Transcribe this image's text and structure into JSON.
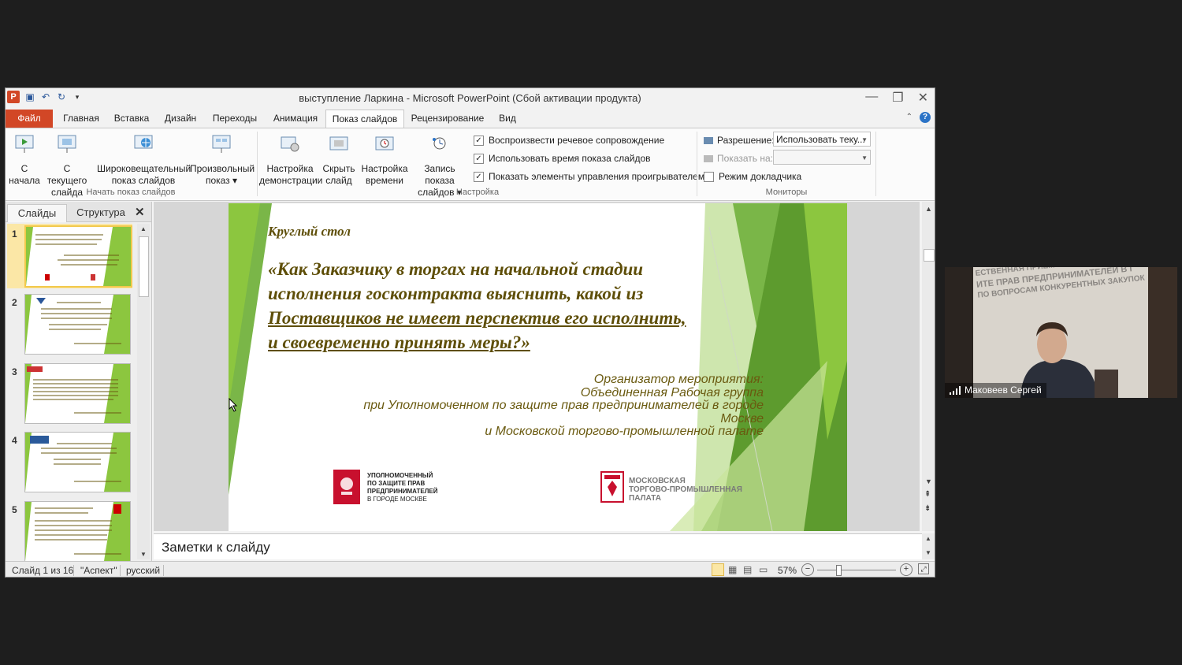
{
  "window": {
    "title": "выступление Ларкина  -  Microsoft PowerPoint (Сбой активации продукта)"
  },
  "tabs": [
    "Файл",
    "Главная",
    "Вставка",
    "Дизайн",
    "Переходы",
    "Анимация",
    "Показ слайдов",
    "Рецензирование",
    "Вид"
  ],
  "ribbon": {
    "start_group": "Начать показ слайдов",
    "setup_group": "Настройка",
    "monitors_group": "Мониторы",
    "btn_from_start": [
      "С",
      "начала"
    ],
    "btn_from_current": [
      "С текущего",
      "слайда"
    ],
    "btn_broadcast": [
      "Широковещательный",
      "показ слайдов"
    ],
    "btn_custom": [
      "Произвольный",
      "показ ▾"
    ],
    "btn_setup": [
      "Настройка",
      "демонстрации"
    ],
    "btn_hide": [
      "Скрыть",
      "слайд"
    ],
    "btn_timing": [
      "Настройка",
      "времени"
    ],
    "btn_record": [
      "Запись показа",
      "слайдов ▾"
    ],
    "chk_narration": "Воспроизвести речевое сопровождение",
    "chk_timings": "Использовать время показа слайдов",
    "chk_media": "Показать элементы управления проигрывателем",
    "resolution_label": "Разрешение:",
    "resolution_value": "Использовать теку...",
    "show_on_label": "Показать на:",
    "presenter_view": "Режим докладчика"
  },
  "panel": {
    "tab_slides": "Слайды",
    "tab_outline": "Структура",
    "close": "✕",
    "numbers": [
      "1",
      "2",
      "3",
      "4",
      "5"
    ]
  },
  "slide": {
    "heading": "Круглый стол",
    "title_lines": [
      "«Как Заказчику в торгах на начальной стадии",
      "исполнения госконтракта выяснить, какой из",
      "Поставщиков не имеет перспектив его исполнить,",
      "и своевременно принять меры?»"
    ],
    "org_lines": [
      "Организатор мероприятия:",
      "Объединенная Рабочая группа",
      "при Уполномоченном по защите прав предпринимателей в городе",
      "Москве",
      "и Московской торгово-промышленной палате"
    ],
    "logo1_lines": [
      "УПОЛНОМОЧЕННЫЙ",
      "ПО ЗАЩИТЕ ПРАВ",
      "ПРЕДПРИНИМАТЕЛЕЙ",
      "В ГОРОДЕ МОСКВЕ"
    ],
    "logo2_lines": [
      "МОСКОВСКАЯ",
      "ТОРГОВО-ПРОМЫШЛЕННАЯ",
      "ПАЛАТА"
    ]
  },
  "notes_placeholder": "Заметки к слайду",
  "status": {
    "slide_info": "Слайд 1 из 16",
    "theme": "\"Аспект\"",
    "language": "русский",
    "zoom": "57%"
  },
  "video": {
    "participant": "Маковеев Сергей",
    "banner_lines": [
      "ЕСТВЕННАЯ ПРИЕМ",
      "ИТЕ ПРАВ ПРЕДПРИНИМАТЕЛЕЙ В Г",
      "ПО ВОПРОСАМ КОНКУРЕНТНЫХ ЗАКУПОК"
    ]
  },
  "colors": {
    "file_tab": "#d24726",
    "slide_title": "#5e4e08",
    "slide_org": "#6a5a10",
    "green": "#7ab648"
  }
}
